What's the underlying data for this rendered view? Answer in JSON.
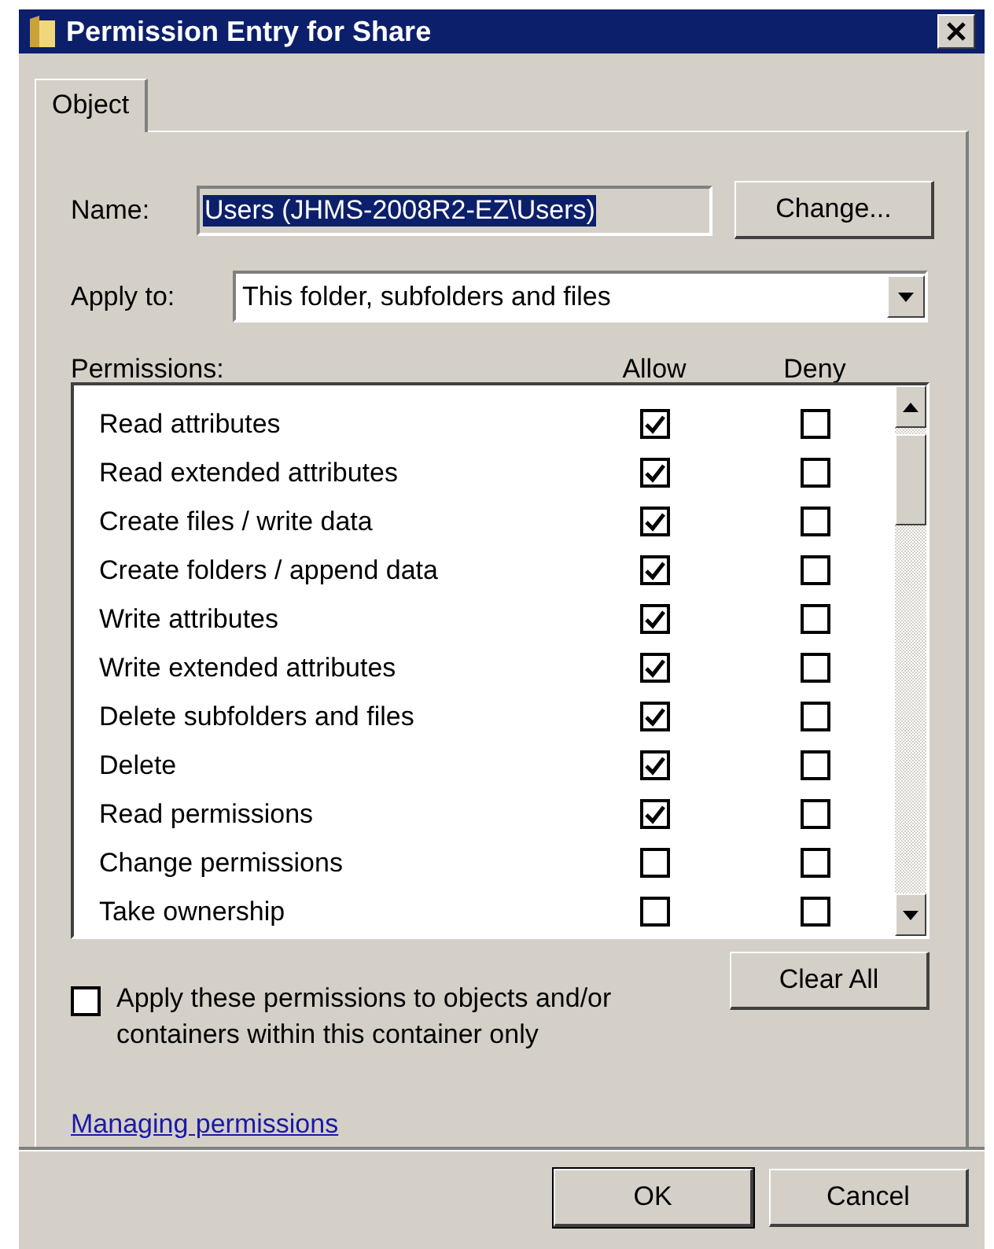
{
  "window": {
    "title": "Permission Entry for Share"
  },
  "tabs": [
    {
      "label": "Object",
      "selected": true
    }
  ],
  "name": {
    "label": "Name:",
    "value": "Users (JHMS-2008R2-EZ\\Users)",
    "button": "Change..."
  },
  "apply_to": {
    "label": "Apply to:",
    "value": "This folder, subfolders and files"
  },
  "permissions": {
    "label": "Permissions:",
    "columns": [
      "Allow",
      "Deny"
    ],
    "rows": [
      {
        "name": "Read attributes",
        "allow": true,
        "deny": false
      },
      {
        "name": "Read extended attributes",
        "allow": true,
        "deny": false
      },
      {
        "name": "Create files / write data",
        "allow": true,
        "deny": false
      },
      {
        "name": "Create folders / append data",
        "allow": true,
        "deny": false
      },
      {
        "name": "Write attributes",
        "allow": true,
        "deny": false
      },
      {
        "name": "Write extended attributes",
        "allow": true,
        "deny": false
      },
      {
        "name": "Delete subfolders and files",
        "allow": true,
        "deny": false
      },
      {
        "name": "Delete",
        "allow": true,
        "deny": false
      },
      {
        "name": "Read permissions",
        "allow": true,
        "deny": false
      },
      {
        "name": "Change permissions",
        "allow": false,
        "deny": false
      },
      {
        "name": "Take ownership",
        "allow": false,
        "deny": false
      }
    ]
  },
  "apply_only": {
    "label": "Apply these permissions to objects and/or containers within this container only",
    "checked": false
  },
  "clear_all": "Clear All",
  "link": "Managing permissions",
  "buttons": [
    "OK",
    "Cancel"
  ]
}
